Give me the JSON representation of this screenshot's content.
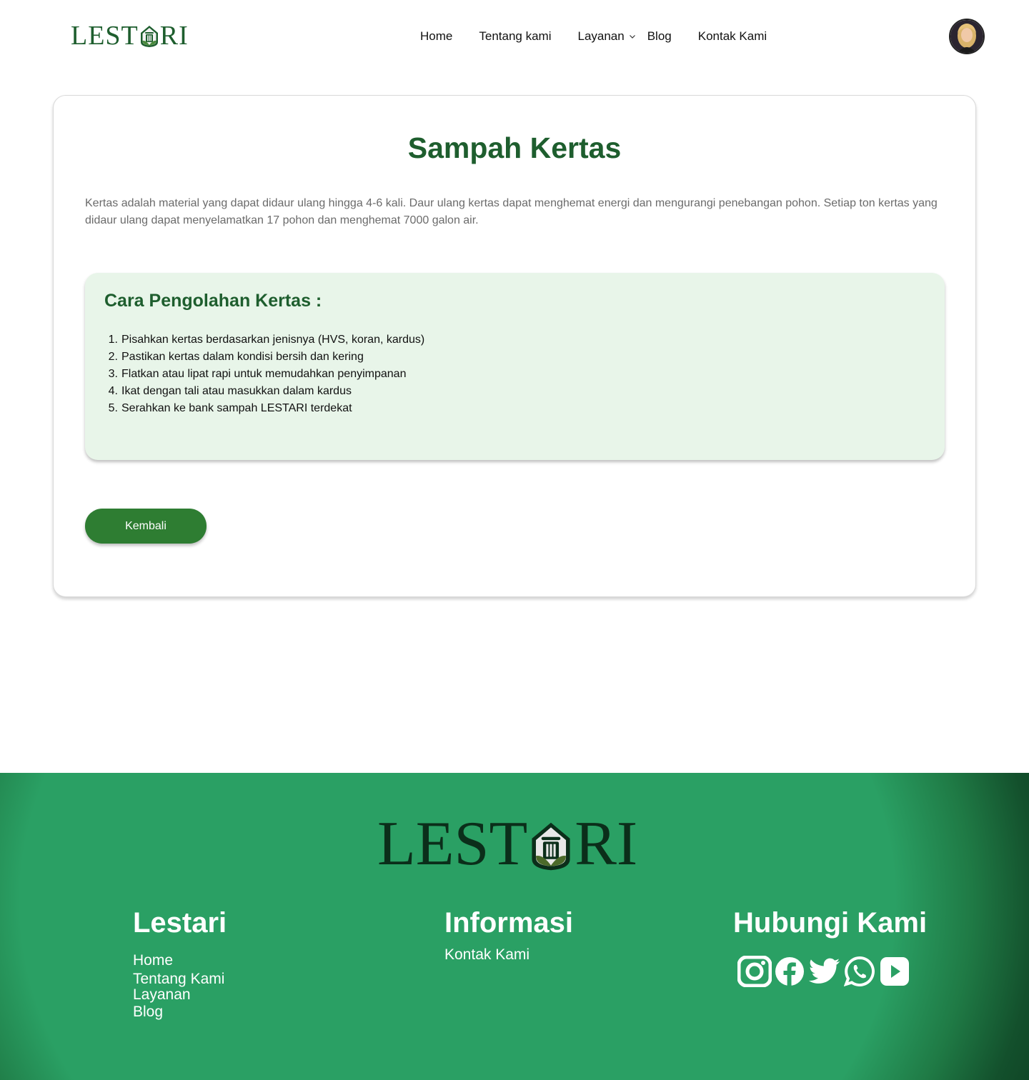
{
  "brand": {
    "name_left": "LEST",
    "name_right": "RI",
    "colors": {
      "primary": "#1e5e2e",
      "button": "#2e7d32",
      "panel": "#e8f5e9",
      "footer": "#2aa064"
    }
  },
  "nav": {
    "home": "Home",
    "tentang": "Tentang kami",
    "layanan": "Layanan",
    "blog": "Blog",
    "kontak": "Kontak Kami"
  },
  "content": {
    "title": "Sampah Kertas",
    "intro": "Kertas adalah material yang dapat didaur ulang hingga 4-6 kali. Daur ulang kertas dapat menghemat energi dan mengurangi penebangan pohon. Setiap ton kertas yang didaur ulang dapat menyelamatkan 17 pohon dan menghemat 7000 galon air.",
    "steps_title": "Cara Pengolahan Kertas :",
    "steps": [
      {
        "num": "1.",
        "text": "Pisahkan kertas berdasarkan jenisnya (HVS, koran, kardus)"
      },
      {
        "num": "2.",
        "text": "Pastikan kertas dalam kondisi bersih dan kering"
      },
      {
        "num": "3.",
        "text": "Flatkan atau lipat rapi untuk memudahkan penyimpanan"
      },
      {
        "num": "4.",
        "text": "Ikat dengan tali atau masukkan dalam kardus"
      },
      {
        "num": "5.",
        "text": "Serahkan ke bank sampah LESTARI terdekat"
      }
    ],
    "back_label": "Kembali"
  },
  "footer": {
    "col1": {
      "title": "Lestari",
      "links": [
        "Home",
        "Tentang Kami",
        "Layanan",
        "Blog"
      ]
    },
    "col2": {
      "title": "Informasi",
      "links": [
        "Kontak Kami"
      ]
    },
    "col3": {
      "title": "Hubungi Kami",
      "icons": [
        "instagram-icon",
        "facebook-icon",
        "twitter-icon",
        "whatsapp-icon",
        "youtube-icon"
      ]
    }
  }
}
